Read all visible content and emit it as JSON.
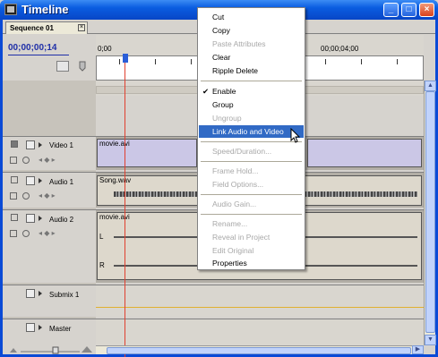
{
  "window": {
    "title": "Timeline"
  },
  "titlebar_buttons": [
    "minimize",
    "maximize",
    "close"
  ],
  "tab": {
    "label": "Sequence 01"
  },
  "timecode": "00;00;00;14",
  "ruler": {
    "labels": [
      "0;00",
      "00;00;04;00"
    ]
  },
  "tracks": [
    {
      "name": "Video 1",
      "type": "video",
      "clip": "movie.avi"
    },
    {
      "name": "Audio 1",
      "type": "audio",
      "clip": "Song.wav"
    },
    {
      "name": "Audio 2",
      "type": "audio",
      "clip": "movie.avi",
      "channels": [
        "L",
        "R"
      ]
    },
    {
      "name": "Submix 1",
      "type": "submix"
    },
    {
      "name": "Master",
      "type": "master"
    }
  ],
  "context_menu": {
    "items": [
      {
        "label": "Cut",
        "disabled": false
      },
      {
        "label": "Copy",
        "disabled": false
      },
      {
        "label": "Paste Attributes",
        "disabled": true
      },
      {
        "label": "Clear",
        "disabled": false
      },
      {
        "label": "Ripple Delete",
        "disabled": false
      },
      {
        "label": "Enable",
        "disabled": false,
        "checked": true
      },
      {
        "label": "Group",
        "disabled": false
      },
      {
        "label": "Ungroup",
        "disabled": true
      },
      {
        "label": "Link Audio and Video",
        "disabled": false,
        "highlighted": true
      },
      {
        "label": "Speed/Duration...",
        "disabled": true
      },
      {
        "label": "Frame Hold...",
        "disabled": true
      },
      {
        "label": "Field Options...",
        "disabled": true
      },
      {
        "label": "Audio Gain...",
        "disabled": true
      },
      {
        "label": "Rename...",
        "disabled": true
      },
      {
        "label": "Reveal in Project",
        "disabled": true
      },
      {
        "label": "Edit Original",
        "disabled": true
      },
      {
        "label": "Properties",
        "disabled": false
      }
    ]
  },
  "icons": {
    "checkmark": "check-icon",
    "close_tab": "close-icon"
  },
  "colors": {
    "titlebar": "#0a5ce0",
    "highlight": "#316ac5",
    "playhead": "#e04030",
    "timecode": "#1f2fa8"
  }
}
